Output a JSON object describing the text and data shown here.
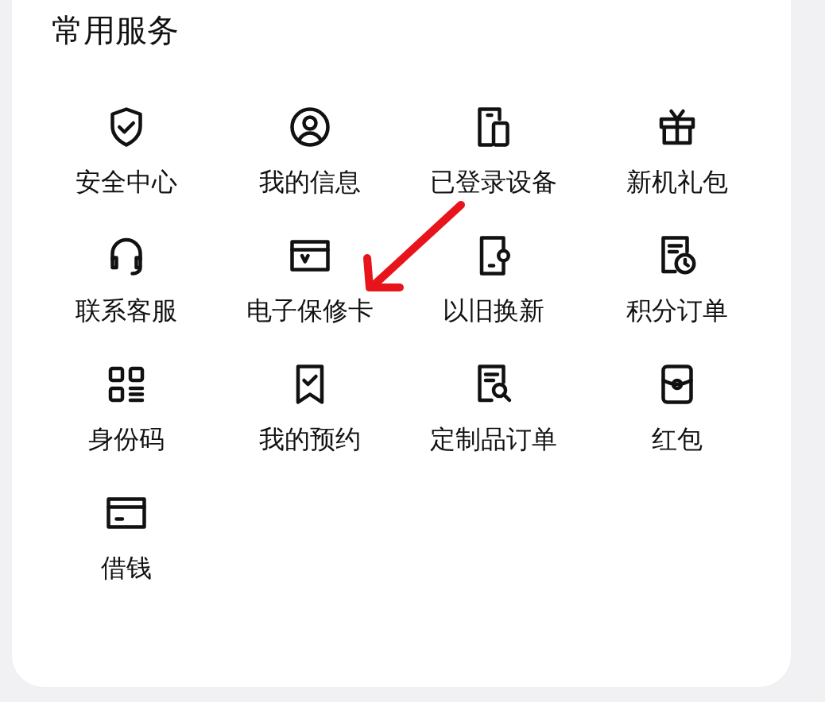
{
  "section": {
    "title": "常用服务"
  },
  "services": [
    {
      "kind": "shield",
      "label": "安全中心"
    },
    {
      "kind": "person",
      "label": "我的信息"
    },
    {
      "kind": "devices",
      "label": "已登录设备"
    },
    {
      "kind": "gift",
      "label": "新机礼包"
    },
    {
      "kind": "headset",
      "label": "联系客服"
    },
    {
      "kind": "warranty",
      "label": "电子保修卡"
    },
    {
      "kind": "trade",
      "label": "以旧换新"
    },
    {
      "kind": "orders",
      "label": "积分订单"
    },
    {
      "kind": "qr",
      "label": "身份码"
    },
    {
      "kind": "bookmark",
      "label": "我的预约"
    },
    {
      "kind": "docsearch",
      "label": "定制品订单"
    },
    {
      "kind": "pouch",
      "label": "红包"
    },
    {
      "kind": "card",
      "label": "借钱"
    }
  ]
}
